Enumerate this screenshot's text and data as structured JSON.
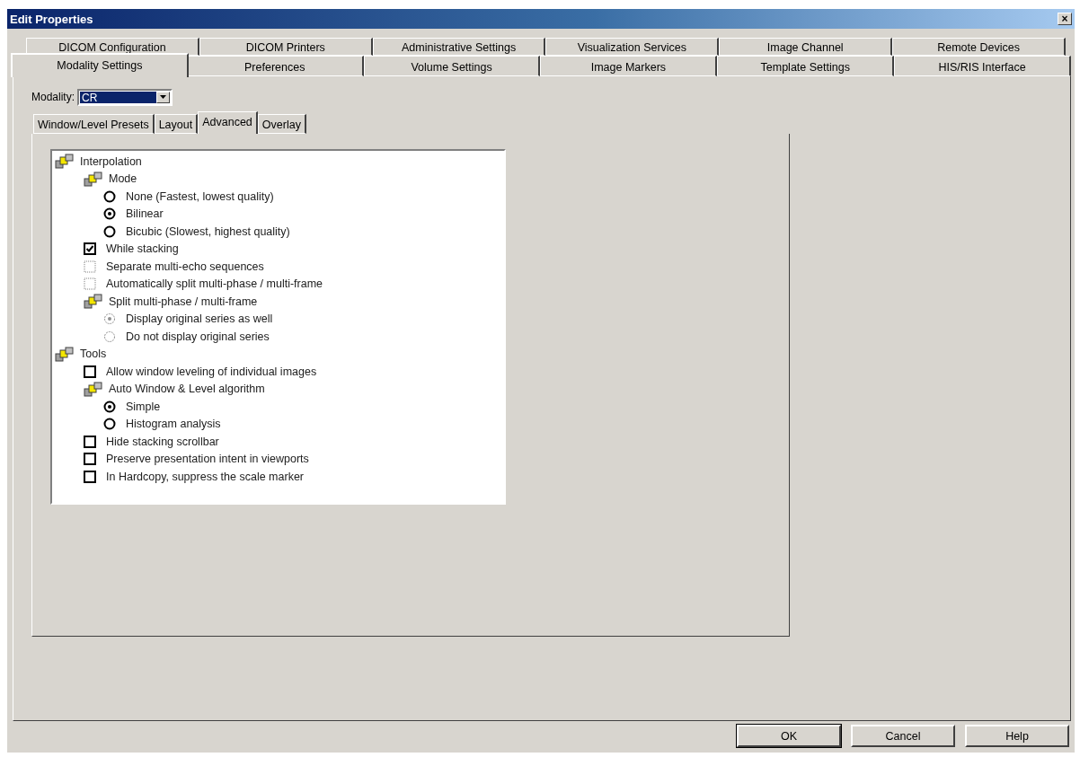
{
  "window": {
    "title": "Edit Properties",
    "close": "×"
  },
  "tab_rows": [
    {
      "tabs": [
        {
          "label": "DICOM Configuration",
          "selected": false
        },
        {
          "label": "DICOM Printers",
          "selected": false
        },
        {
          "label": "Administrative Settings",
          "selected": false
        },
        {
          "label": "Visualization Services",
          "selected": false
        },
        {
          "label": "Image Channel",
          "selected": false
        },
        {
          "label": "Remote Devices",
          "selected": false
        }
      ]
    },
    {
      "tabs": [
        {
          "label": "Modality Settings",
          "selected": true
        },
        {
          "label": "Preferences",
          "selected": false
        },
        {
          "label": "Volume Settings",
          "selected": false
        },
        {
          "label": "Image Markers",
          "selected": false
        },
        {
          "label": "Template Settings",
          "selected": false
        },
        {
          "label": "HIS/RIS Interface",
          "selected": false
        }
      ]
    }
  ],
  "modality": {
    "label": "Modality:",
    "value": "CR"
  },
  "subtabs": [
    {
      "label": "Window/Level Presets",
      "selected": false
    },
    {
      "label": "Layout",
      "selected": false
    },
    {
      "label": "Advanced",
      "selected": true
    },
    {
      "label": "Overlay",
      "selected": false
    }
  ],
  "tree": [
    {
      "kind": "group",
      "label": "Interpolation",
      "children": [
        {
          "kind": "group",
          "label": "Mode",
          "children": [
            {
              "kind": "radio",
              "label": "None (Fastest, lowest quality)",
              "selected": false,
              "disabled": false
            },
            {
              "kind": "radio",
              "label": "Bilinear",
              "selected": true,
              "disabled": false
            },
            {
              "kind": "radio",
              "label": "Bicubic (Slowest, highest quality)",
              "selected": false,
              "disabled": false
            }
          ]
        },
        {
          "kind": "checkbox",
          "label": "While stacking",
          "checked": true,
          "disabled": false
        },
        {
          "kind": "checkbox",
          "label": "Separate multi-echo sequences",
          "checked": false,
          "disabled": true
        },
        {
          "kind": "checkbox",
          "label": "Automatically split multi-phase / multi-frame",
          "checked": false,
          "disabled": true
        },
        {
          "kind": "group",
          "label": "Split multi-phase / multi-frame",
          "children": [
            {
              "kind": "radio",
              "label": "Display original series as well",
              "selected": true,
              "disabled": true
            },
            {
              "kind": "radio",
              "label": "Do not display original series",
              "selected": false,
              "disabled": true
            }
          ]
        }
      ]
    },
    {
      "kind": "group",
      "label": "Tools",
      "children": [
        {
          "kind": "checkbox",
          "label": "Allow window leveling of individual images",
          "checked": false,
          "disabled": false
        },
        {
          "kind": "group",
          "label": "Auto Window & Level algorithm",
          "children": [
            {
              "kind": "radio",
              "label": "Simple",
              "selected": true,
              "disabled": false
            },
            {
              "kind": "radio",
              "label": "Histogram analysis",
              "selected": false,
              "disabled": false
            }
          ]
        },
        {
          "kind": "checkbox",
          "label": "Hide stacking scrollbar",
          "checked": false,
          "disabled": false
        },
        {
          "kind": "checkbox",
          "label": "Preserve presentation intent in viewports",
          "checked": false,
          "disabled": false
        },
        {
          "kind": "checkbox",
          "label": "In Hardcopy, suppress the scale marker",
          "checked": false,
          "disabled": false
        }
      ]
    }
  ],
  "buttons": [
    {
      "label": "OK",
      "default": true
    },
    {
      "label": "Cancel",
      "default": false
    },
    {
      "label": "Help",
      "default": false
    }
  ]
}
